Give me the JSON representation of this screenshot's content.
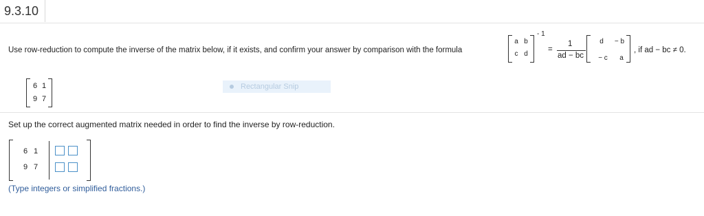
{
  "problem": {
    "number": "9.3.10"
  },
  "question": {
    "text": "Use row-reduction to compute the inverse of the matrix below, if it exists, and confirm your answer by comparison with the formula",
    "formula": {
      "lhs": {
        "r1c1": "a",
        "r1c2": "b",
        "r2c1": "c",
        "r2c2": "d",
        "exp": "- 1"
      },
      "eq": "=",
      "num": "1",
      "den": "ad − bc",
      "rhs": {
        "r1c1": "d",
        "r1c2": "− b",
        "r2c1": "− c",
        "r2c2": "a"
      },
      "tail": ", if ad − bc ≠ 0."
    },
    "matrix": {
      "r1c1": "6",
      "r1c2": "1",
      "r2c1": "9",
      "r2c2": "7"
    }
  },
  "overlay": {
    "snip_label": "Rectangular Snip"
  },
  "part": {
    "instruction": "Set up the correct augmented matrix needed in order to find the inverse by row-reduction.",
    "augmented": {
      "left": {
        "r1c1": "6",
        "r1c2": "1",
        "r2c1": "9",
        "r2c2": "7"
      },
      "inputs": {
        "r1c1": "",
        "r1c2": "",
        "r2c1": "",
        "r2c2": ""
      }
    },
    "hint": "(Type integers or simplified fractions.)"
  }
}
